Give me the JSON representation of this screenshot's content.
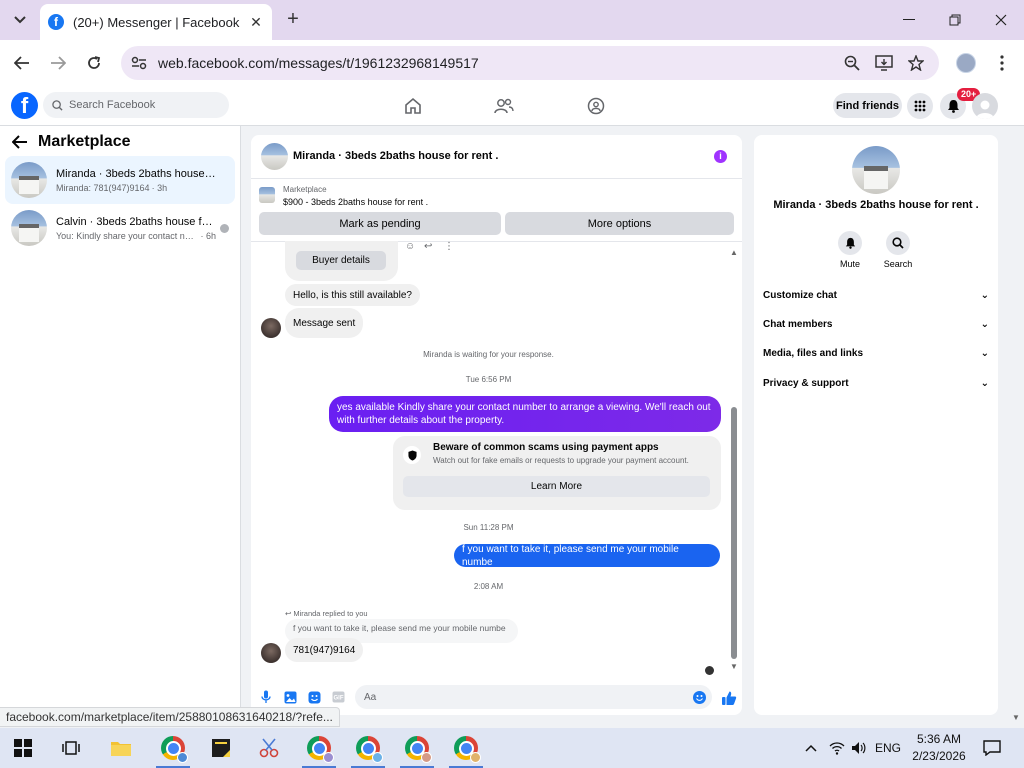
{
  "browser": {
    "tab_title": "(20+) Messenger | Facebook",
    "url": "web.facebook.com/messages/t/1961232968149517",
    "status_url": "facebook.com/marketplace/item/25880108631640218/?refe..."
  },
  "fb_header": {
    "search_placeholder": "Search Facebook",
    "find_friends": "Find friends",
    "notification_badge": "20+"
  },
  "sidebar": {
    "title": "Marketplace",
    "conversations": [
      {
        "name": "Miranda · 3beds 2baths house for ...",
        "preview": "Miranda: 781(947)9164",
        "time": "· 3h",
        "active": true
      },
      {
        "name": "Calvin · 3beds 2baths house for ...",
        "preview": "You: Kindly share your contact num...",
        "time": "· 6h",
        "active": false
      }
    ]
  },
  "chat": {
    "header_name": "Miranda · 3beds 2baths house for rent .",
    "marketplace_label": "Marketplace",
    "marketplace_item": "$900 - 3beds 2baths house for rent .",
    "mark_pending": "Mark as pending",
    "more_options": "More options",
    "buyer_details": "Buyer details",
    "messages": {
      "m1": "Hello, is this still available?",
      "m2": "Message sent",
      "waiting": "Miranda is waiting for your response.",
      "ts1": "Tue 6:56 PM",
      "out1": "yes available Kindly share your contact number to arrange a viewing. We'll reach out with further details about the property.",
      "scam_title": "Beware of common scams using payment apps",
      "scam_sub": "Watch out for fake emails or requests to upgrade your payment account.",
      "learn_more": "Learn More",
      "ts2": "Sun 11:28 PM",
      "out2": "f you want to take it, please send me your mobile numbe",
      "ts3": "2:08 AM",
      "reply_label": "Miranda replied to you",
      "reply_quote": "f you want to take it, please send me your mobile numbe",
      "in_reply": "781(947)9164"
    },
    "composer_placeholder": "Aa"
  },
  "info_panel": {
    "name": "Miranda · 3beds 2baths house for rent .",
    "mute": "Mute",
    "search": "Search",
    "rows": [
      "Customize chat",
      "Chat members",
      "Media, files and links",
      "Privacy & support"
    ]
  },
  "taskbar": {
    "lang": "ENG",
    "time": "5:36 AM",
    "date": "2/23/2026"
  },
  "colors": {
    "accent_purple": "#7d2ae8",
    "accent_blue": "#1a64f0",
    "fb_blue": "#0866ff"
  }
}
